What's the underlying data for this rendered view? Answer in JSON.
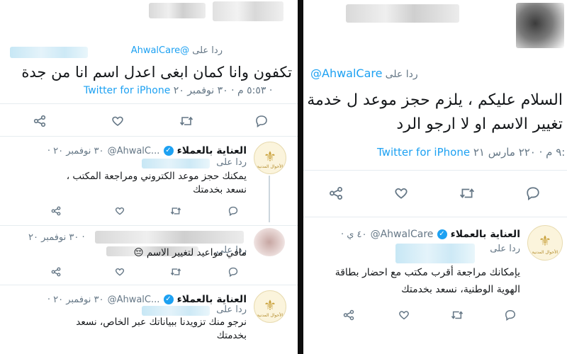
{
  "left": {
    "main_tweet": {
      "reply_prefix": "ردا على",
      "reply_handle": "@AhwalCare",
      "text": "تكفون وانا كمان ابغى اعدل اسم انا من جدة",
      "time": "٥:٥٣ م · ٣٠ نوفمبر ٢٠ ·",
      "source": "Twitter for iPhone"
    },
    "replies": [
      {
        "name": "العناية بالعملاء",
        "handle": "@AhwalC...",
        "date": "· ٣٠ نوفمبر ٢٠",
        "reply_prefix": "ردا على",
        "lines": [
          "يمكنك حجز موعد الكتروني ومراجعة المكتب ،",
          "نسعد بخدمتك"
        ]
      },
      {
        "name": "",
        "date": "· ٣٠ نوفمبر ٢٠",
        "reply_prefix": "ردا على",
        "lines": [
          "مافي مواعيد لتغيير الاسم"
        ],
        "emoji": "😔"
      },
      {
        "name": "العناية بالعملاء",
        "handle": "@AhwalC...",
        "date": "· ٣٠ نوفمبر ٢٠",
        "reply_prefix": "ردا على",
        "lines": [
          "نرجو منك تزويدنا ببياناتك عبر الخاص، نسعد",
          "بخدمتك"
        ]
      }
    ]
  },
  "right": {
    "main_tweet": {
      "reply_prefix": "ردا على",
      "reply_handle": "@AhwalCare",
      "lines": [
        "السلام عليكم ، يلزم حجز موعد ل خدمة",
        "تغيير الاسم او لا ارجو الرد"
      ],
      "time": "٩:٠٥ م · ٢٢٠ مارس ٢١ ·",
      "source": "Twitter for iPhone"
    },
    "reply": {
      "name": "العناية بالعملاء",
      "handle": "@AhwalCare",
      "date": "· ٤٠ ي",
      "reply_prefix": "ردا على",
      "lines": [
        "يإمكانك مراجعة أقرب مكتب مع احضار بطاقة",
        "الهوية الوطنية، نسعد بخدمتك"
      ]
    }
  },
  "avatar_label": "الأحوال المدنية",
  "icons": {
    "share": "share-icon",
    "like": "heart-icon",
    "retweet": "retweet-icon",
    "reply": "reply-icon",
    "verified": "verified-badge-icon"
  },
  "colors": {
    "accent": "#1da1f2",
    "muted": "#657786",
    "text": "#14171a"
  }
}
